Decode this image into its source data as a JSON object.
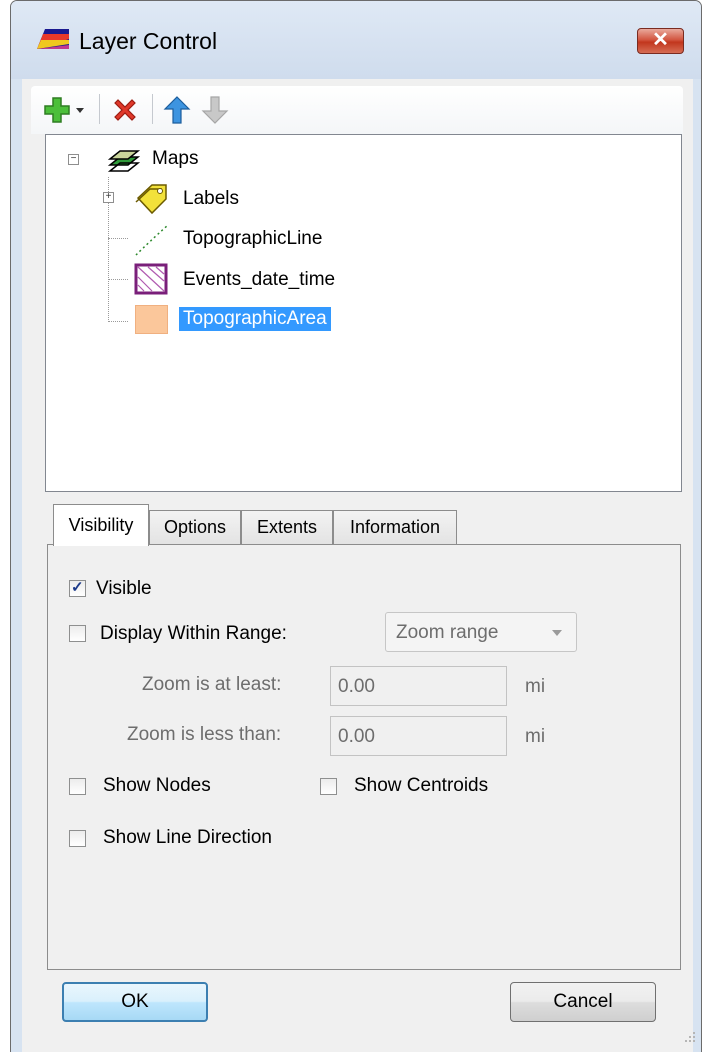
{
  "window": {
    "title": "Layer Control",
    "close_glyph": "✕"
  },
  "toolbar": {
    "items": [
      {
        "name": "add-layer",
        "icon": "green-plus-icon"
      },
      {
        "name": "add-dropdown",
        "icon": "dropdown-arrow-icon"
      },
      {
        "name": "remove-layer",
        "icon": "red-x-icon"
      },
      {
        "name": "move-up",
        "icon": "blue-up-arrow-icon"
      },
      {
        "name": "move-down",
        "icon": "gray-down-arrow-icon",
        "disabled": true
      }
    ]
  },
  "tree": {
    "root": "Maps",
    "items": [
      {
        "label": "Labels",
        "icon": "labels-tag-icon",
        "expandable": true
      },
      {
        "label": "TopographicLine",
        "icon": "dotted-line-icon"
      },
      {
        "label": "Events_date_time",
        "icon": "hatched-area-icon"
      },
      {
        "label": "TopographicArea",
        "icon": "peach-area-icon",
        "selected": true
      }
    ]
  },
  "tabs": {
    "items": [
      {
        "label": "Visibility",
        "active": true
      },
      {
        "label": "Options"
      },
      {
        "label": "Extents"
      },
      {
        "label": "Information"
      }
    ]
  },
  "visibility": {
    "visible_label": "Visible",
    "visible_checked": true,
    "range_label": "Display Within Range:",
    "range_checked": false,
    "range_select": "Zoom range",
    "min_label": "Zoom is at least:",
    "min_value": "0.00",
    "min_unit": "mi",
    "max_label": "Zoom is less than:",
    "max_value": "0.00",
    "max_unit": "mi",
    "nodes_label": "Show Nodes",
    "nodes_checked": false,
    "centroids_label": "Show Centroids",
    "centroids_checked": false,
    "direction_label": "Show Line Direction",
    "direction_checked": false
  },
  "buttons": {
    "ok": "OK",
    "cancel": "Cancel"
  },
  "colors": {
    "selection": "#3399ff",
    "peach": "#fbc79b",
    "hatch": "#7a1f7a",
    "close": "#c9412a"
  }
}
